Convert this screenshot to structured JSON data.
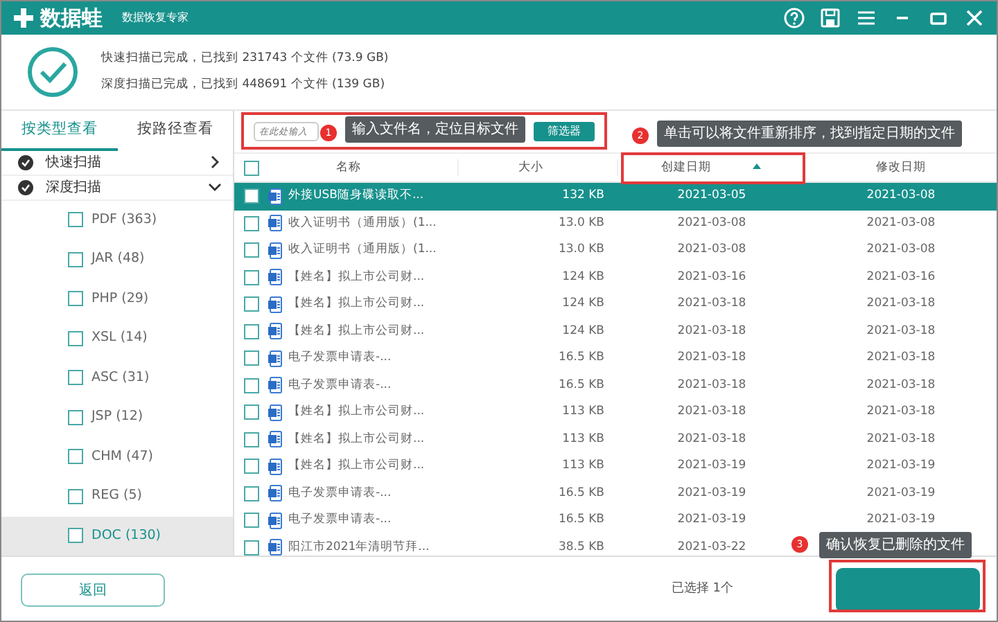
{
  "window": {
    "title": "数据蛙",
    "subtitle": "数据恢复专家"
  },
  "scan_summary": [
    "快速扫描已完成，已找到 231743 个文件 (73.9 GB)",
    "深度扫描已完成，已找到 448691 个文件 (139 GB)"
  ],
  "sidebar": {
    "tabs": [
      {
        "label": "按类型查看",
        "selected": true
      },
      {
        "label": "按路径查看",
        "selected": false
      }
    ],
    "groups": [
      {
        "label": "快速扫描",
        "checked": true,
        "expanded": false
      },
      {
        "label": "深度扫描",
        "checked": true,
        "expanded": true,
        "children": [
          {
            "label": "PDF (363)",
            "checked": false,
            "selected": false
          },
          {
            "label": "JAR (48)",
            "checked": false,
            "selected": false
          },
          {
            "label": "PHP (29)",
            "checked": false,
            "selected": false
          },
          {
            "label": "XSL (14)",
            "checked": false,
            "selected": false
          },
          {
            "label": "ASC (31)",
            "checked": false,
            "selected": false
          },
          {
            "label": "JSP (12)",
            "checked": false,
            "selected": false
          },
          {
            "label": "CHM (47)",
            "checked": false,
            "selected": false
          },
          {
            "label": "REG (5)",
            "checked": false,
            "selected": false
          },
          {
            "label": "DOC (130)",
            "checked": false,
            "selected": true
          }
        ]
      }
    ]
  },
  "search": {
    "placeholder": "在此处输入"
  },
  "filter_button": "筛选器",
  "table": {
    "select_all_checked": false,
    "columns": [
      {
        "label": "名称",
        "sorted": false
      },
      {
        "label": "大小",
        "sorted": false
      },
      {
        "label": "创建日期",
        "sorted": true
      },
      {
        "label": "修改日期",
        "sorted": false
      }
    ],
    "rows": [
      {
        "name": "外接USB随身碟读取不...",
        "size": "132 KB",
        "created": "2021-03-05",
        "modified": "2021-03-08",
        "checked": false,
        "selected": true
      },
      {
        "name": "收入证明书（通用版）(1...",
        "size": "13.0 KB",
        "created": "2021-03-08",
        "modified": "2021-03-08",
        "checked": false,
        "selected": false
      },
      {
        "name": "收入证明书（通用版）(1...",
        "size": "13.0 KB",
        "created": "2021-03-08",
        "modified": "2021-03-08",
        "checked": false,
        "selected": false
      },
      {
        "name": "【姓名】拟上市公司财...",
        "size": "124 KB",
        "created": "2021-03-16",
        "modified": "2021-03-16",
        "checked": false,
        "selected": false
      },
      {
        "name": "【姓名】拟上市公司财...",
        "size": "124 KB",
        "created": "2021-03-18",
        "modified": "2021-03-18",
        "checked": false,
        "selected": false
      },
      {
        "name": "【姓名】拟上市公司财...",
        "size": "124 KB",
        "created": "2021-03-18",
        "modified": "2021-03-18",
        "checked": false,
        "selected": false
      },
      {
        "name": "电子发票申请表-...",
        "size": "16.5 KB",
        "created": "2021-03-18",
        "modified": "2021-03-18",
        "checked": false,
        "selected": false
      },
      {
        "name": "电子发票申请表-...",
        "size": "16.5 KB",
        "created": "2021-03-18",
        "modified": "2021-03-18",
        "checked": false,
        "selected": false
      },
      {
        "name": "【姓名】拟上市公司财...",
        "size": "113 KB",
        "created": "2021-03-18",
        "modified": "2021-03-18",
        "checked": false,
        "selected": false
      },
      {
        "name": "【姓名】拟上市公司财...",
        "size": "113 KB",
        "created": "2021-03-18",
        "modified": "2021-03-18",
        "checked": false,
        "selected": false
      },
      {
        "name": "【姓名】拟上市公司财...",
        "size": "113 KB",
        "created": "2021-03-19",
        "modified": "2021-03-19",
        "checked": false,
        "selected": false
      },
      {
        "name": "电子发票申请表-...",
        "size": "16.5 KB",
        "created": "2021-03-19",
        "modified": "2021-03-19",
        "checked": false,
        "selected": false
      },
      {
        "name": "电子发票申请表-...",
        "size": "16.5 KB",
        "created": "2021-03-19",
        "modified": "2021-03-19",
        "checked": false,
        "selected": false
      },
      {
        "name": "阳江市2021年清明节拜...",
        "size": "38.5 KB",
        "created": "2021-03-22",
        "checked": false,
        "selected": false
      }
    ]
  },
  "footer": {
    "back_button": "返回",
    "status": "已选择 1个"
  },
  "annotations": [
    {
      "number": "1",
      "text": "输入文件名，定位目标文件"
    },
    {
      "number": "2",
      "text": "单击可以将文件重新排序，找到指定日期的文件"
    },
    {
      "number": "3",
      "text": "确认恢复已删除的文件"
    }
  ]
}
